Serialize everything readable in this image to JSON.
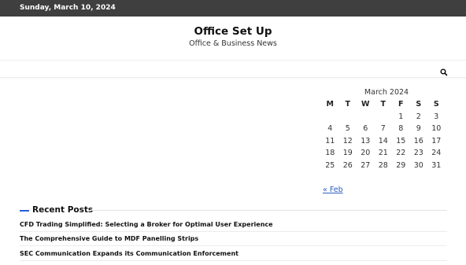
{
  "topbar": {
    "date": "Sunday, March 10, 2024"
  },
  "site": {
    "title": "Office Set Up",
    "description": "Office & Business News"
  },
  "nav": {
    "search_icon": "search-icon"
  },
  "calendar": {
    "caption": "March 2024",
    "weekdays": [
      "M",
      "T",
      "W",
      "T",
      "F",
      "S",
      "S"
    ],
    "weeks": [
      [
        "",
        "",
        "",
        "",
        "1",
        "2",
        "3"
      ],
      [
        "4",
        "5",
        "6",
        "7",
        "8",
        "9",
        "10"
      ],
      [
        "11",
        "12",
        "13",
        "14",
        "15",
        "16",
        "17"
      ],
      [
        "18",
        "19",
        "20",
        "21",
        "22",
        "23",
        "24"
      ],
      [
        "25",
        "26",
        "27",
        "28",
        "29",
        "30",
        "31"
      ]
    ],
    "prev_link": "« Feb"
  },
  "recent_posts": {
    "title": "Recent Posts",
    "items": [
      "CFD Trading Simplified: Selecting a Broker for Optimal User Experience",
      "The Comprehensive Guide to MDF Panelling Strips",
      "SEC Communication Expands its Communication Enforcement"
    ]
  },
  "colors": {
    "topbar_bg": "#3f3f3f",
    "accent": "#2a5fd6",
    "link": "#2a5fbf"
  }
}
